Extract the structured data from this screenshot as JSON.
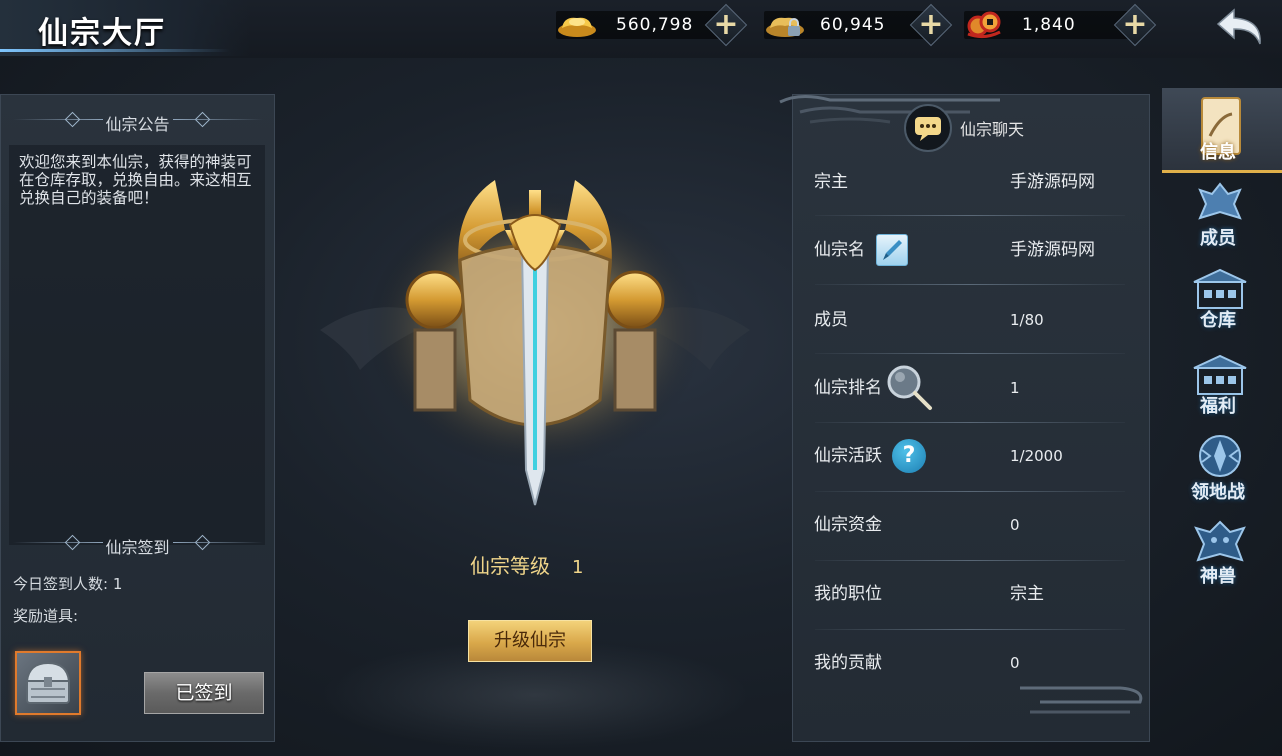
{
  "header": {
    "title": "仙宗大厅",
    "currencies": [
      {
        "icon": "gold-ingot-icon",
        "value": "560,798"
      },
      {
        "icon": "locked-ingot-icon",
        "value": "60,945"
      },
      {
        "icon": "copper-coin-icon",
        "value": "1,840"
      }
    ],
    "back_icon": "back-arrow-icon"
  },
  "left": {
    "notice_title": "仙宗公告",
    "notice_text": "欢迎您来到本仙宗，获得的神装可在仓库存取，兑换自由。来这相互兑换自己的装备吧！",
    "sign_title": "仙宗签到",
    "today_signins": "今日签到人数: 1",
    "reward_label": "奖励道具:",
    "reward_item_icon": "treasure-chest-icon",
    "signed_button": "已签到"
  },
  "center": {
    "level_label": "仙宗等级",
    "level_value": "1",
    "upgrade_button": "升级仙宗"
  },
  "info": {
    "chat_label": "仙宗聊天",
    "rows": [
      {
        "key": "宗主",
        "value": "手游源码网"
      },
      {
        "key": "仙宗名",
        "value": "手游源码网"
      },
      {
        "key": "成员",
        "value": "1/80"
      },
      {
        "key": "仙宗排名",
        "value": "1"
      },
      {
        "key": "仙宗活跃",
        "value": "1/2000"
      },
      {
        "key": "仙宗资金",
        "value": "0"
      },
      {
        "key": "我的职位",
        "value": "宗主"
      },
      {
        "key": "我的贡献",
        "value": "0"
      }
    ],
    "help_glyph": "?"
  },
  "tabs": [
    {
      "label": "信息",
      "icon": "scroll-icon",
      "active": true
    },
    {
      "label": "成员",
      "icon": "members-icon",
      "active": false
    },
    {
      "label": "仓库",
      "icon": "warehouse-icon",
      "active": false
    },
    {
      "label": "福利",
      "icon": "welfare-icon",
      "active": false
    },
    {
      "label": "领地战",
      "icon": "territory-war-icon",
      "active": false
    },
    {
      "label": "神兽",
      "icon": "divine-beast-icon",
      "active": false
    }
  ],
  "colors": {
    "gold_text": "#f0d58a",
    "accent_orange": "#e07a2c",
    "active_tab_underline": "#e0b04a"
  }
}
